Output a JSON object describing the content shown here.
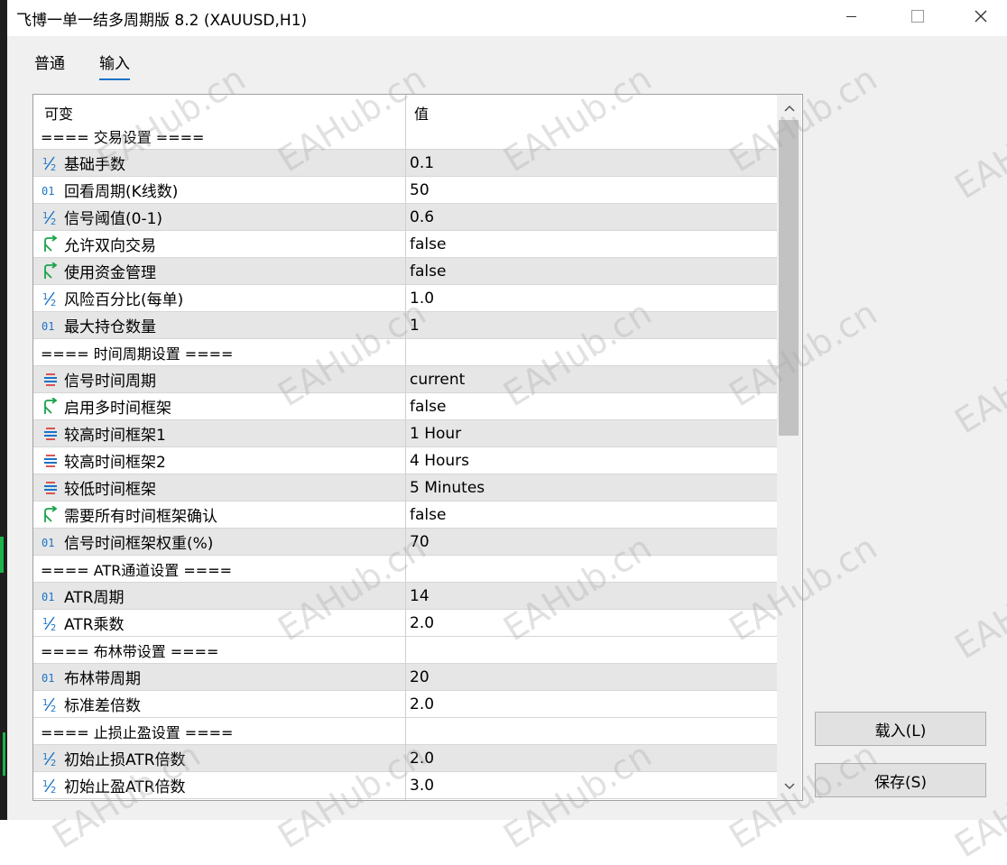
{
  "window": {
    "title": "飞博一单一结多周期版 8.2 (XAUUSD,H1)"
  },
  "tabs": [
    {
      "label": "普通",
      "active": false
    },
    {
      "label": "输入",
      "active": true
    }
  ],
  "grid": {
    "col_variable": "可变",
    "col_value": "值",
    "rows": [
      {
        "type": "section",
        "label": "==== 交易设置 ===="
      },
      {
        "icon": "double-icon",
        "label": "基础手数",
        "value": "0.1"
      },
      {
        "icon": "int-icon",
        "label": "回看周期(K线数)",
        "value": "50"
      },
      {
        "icon": "double-icon",
        "label": "信号阈值(0-1)",
        "value": "0.6"
      },
      {
        "icon": "bool-icon",
        "label": "允许双向交易",
        "value": "false"
      },
      {
        "icon": "bool-icon",
        "label": "使用资金管理",
        "value": "false"
      },
      {
        "icon": "double-icon",
        "label": "风险百分比(每单)",
        "value": "1.0"
      },
      {
        "icon": "int-icon",
        "label": "最大持仓数量",
        "value": "1"
      },
      {
        "type": "section",
        "label": "==== 时间周期设置 ===="
      },
      {
        "icon": "enum-icon",
        "label": "信号时间周期",
        "value": "current"
      },
      {
        "icon": "bool-icon",
        "label": "启用多时间框架",
        "value": "false"
      },
      {
        "icon": "enum-icon",
        "label": "较高时间框架1",
        "value": "1 Hour"
      },
      {
        "icon": "enum-icon",
        "label": "较高时间框架2",
        "value": "4 Hours"
      },
      {
        "icon": "enum-icon",
        "label": "较低时间框架",
        "value": "5 Minutes"
      },
      {
        "icon": "bool-icon",
        "label": "需要所有时间框架确认",
        "value": "false"
      },
      {
        "icon": "int-icon",
        "label": "信号时间框架权重(%)",
        "value": "70"
      },
      {
        "type": "section",
        "label": "==== ATR通道设置 ===="
      },
      {
        "icon": "int-icon",
        "label": "ATR周期",
        "value": "14"
      },
      {
        "icon": "double-icon",
        "label": "ATR乘数",
        "value": "2.0"
      },
      {
        "type": "section",
        "label": "==== 布林带设置 ===="
      },
      {
        "icon": "int-icon",
        "label": "布林带周期",
        "value": "20"
      },
      {
        "icon": "double-icon",
        "label": "标准差倍数",
        "value": "2.0"
      },
      {
        "type": "section",
        "label": "==== 止损止盈设置 ===="
      },
      {
        "icon": "double-icon",
        "label": "初始止损ATR倍数",
        "value": "2.0"
      },
      {
        "icon": "double-icon",
        "label": "初始止盈ATR倍数",
        "value": "3.0"
      }
    ]
  },
  "buttons": {
    "load": "载入(L)",
    "save": "保存(S)"
  },
  "watermark": "EAHub.cn",
  "colors": {
    "accent": "#1a73c7",
    "bool_icon": "#1aa34a",
    "enum_icon_red": "#d9534f",
    "enum_icon_blue": "#1a73c7"
  }
}
